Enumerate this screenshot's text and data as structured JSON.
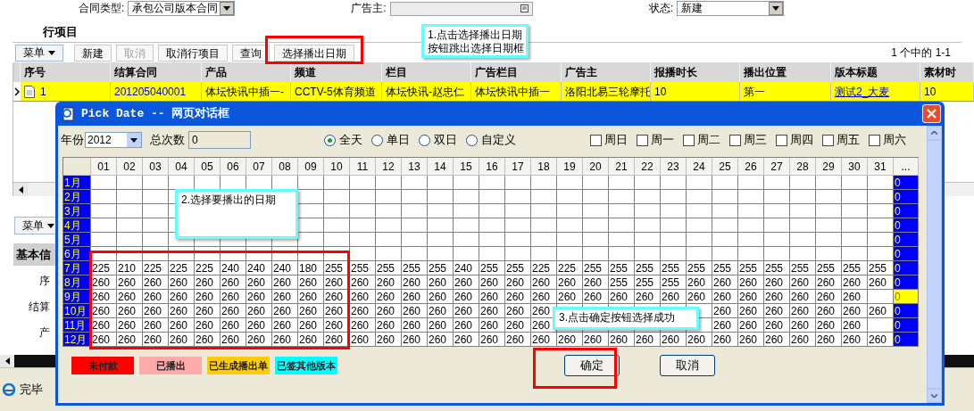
{
  "form": [
    {
      "label": "合同类型:",
      "value": "承包公司版本合同",
      "kind": "select"
    },
    {
      "label": "广告主:",
      "kind": "lookup"
    },
    {
      "label": "状态:",
      "value": "新建",
      "kind": "select"
    }
  ],
  "section_title": "行项目",
  "toolbar": [
    {
      "label": "菜单",
      "kind": "menu",
      "disabled": false
    },
    {
      "label": "新建",
      "kind": "button",
      "disabled": false
    },
    {
      "label": "取消",
      "kind": "button",
      "disabled": true
    },
    {
      "label": "取消行项目",
      "kind": "button",
      "disabled": false
    },
    {
      "label": "查询",
      "kind": "button",
      "disabled": false
    },
    {
      "label": "选择播出日期",
      "kind": "button",
      "disabled": false
    }
  ],
  "pager": "1 个中的 1-1",
  "table": {
    "columns": [
      "序号",
      "结算合同",
      "产品",
      "频道",
      "栏目",
      "广告栏目",
      "广告主",
      "报播时长",
      "播出位置",
      "版本标题",
      "素材时"
    ],
    "rows": [
      {
        "selected": true,
        "cells": [
          {
            "text": "1",
            "kind": "text"
          },
          {
            "text": "201205040001",
            "kind": "link"
          },
          {
            "text": "体坛快讯中插一-",
            "kind": "text"
          },
          {
            "text": "CCTV-5体育频道",
            "kind": "text"
          },
          {
            "text": "体坛快讯-赵忠仁",
            "kind": "text"
          },
          {
            "text": "体坛快讯中插一",
            "kind": "text"
          },
          {
            "text": "洛阳北易三轮摩托",
            "kind": "text"
          },
          {
            "text": "10",
            "kind": "text"
          },
          {
            "text": "第一",
            "kind": "text"
          },
          {
            "text": "测试2_大麦",
            "kind": "underline"
          },
          {
            "text": "10",
            "kind": "text"
          }
        ]
      }
    ]
  },
  "lower": {
    "menu": "菜单",
    "section": "基本信",
    "fields": [
      "序",
      "结算",
      "产"
    ]
  },
  "status_bar": {
    "text": "完毕"
  },
  "dialog": {
    "title": "Pick Date -- 网页对话框",
    "year": {
      "label": "年份",
      "value": "2012"
    },
    "total": {
      "label": "总次数",
      "value": "0"
    },
    "day_modes": [
      {
        "label": "全天",
        "selected": true
      },
      {
        "label": "单日",
        "selected": false
      },
      {
        "label": "双日",
        "selected": false
      },
      {
        "label": "自定义",
        "selected": false
      }
    ],
    "weekdays": [
      {
        "label": "周日",
        "checked": false
      },
      {
        "label": "周一",
        "checked": false
      },
      {
        "label": "周二",
        "checked": false
      },
      {
        "label": "周三",
        "checked": false
      },
      {
        "label": "周四",
        "checked": false
      },
      {
        "label": "周五",
        "checked": false
      },
      {
        "label": "周六",
        "checked": false
      }
    ],
    "grid": {
      "columns": [
        "01",
        "02",
        "03",
        "04",
        "05",
        "06",
        "07",
        "08",
        "09",
        "10",
        "11",
        "12",
        "13",
        "14",
        "15",
        "16",
        "17",
        "18",
        "19",
        "20",
        "21",
        "22",
        "23",
        "24",
        "25",
        "26",
        "27",
        "28",
        "29",
        "30",
        "31",
        "..."
      ],
      "rows": [
        {
          "label": "1月",
          "total": "0",
          "highlighted": false
        },
        {
          "label": "2月",
          "total": "0",
          "highlighted": false
        },
        {
          "label": "3月",
          "total": "0",
          "highlighted": false
        },
        {
          "label": "4月",
          "total": "0",
          "highlighted": false
        },
        {
          "label": "5月",
          "total": "0",
          "highlighted": false
        },
        {
          "label": "6月",
          "total": "0",
          "highlighted": false
        },
        {
          "label": "7月",
          "total": "0",
          "highlighted": false,
          "cells": [
            "225",
            "210",
            "225",
            "225",
            "225",
            "240",
            "240",
            "240",
            "180",
            "255",
            "255",
            "255",
            "255",
            "255",
            "240",
            "255",
            "255",
            "225",
            "225",
            "255",
            "255",
            "255",
            "255",
            "255",
            "255",
            "255",
            "255",
            "255",
            "255",
            "255",
            "255"
          ]
        },
        {
          "label": "8月",
          "total": "0",
          "highlighted": false,
          "cells": [
            "260",
            "260",
            "260",
            "260",
            "260",
            "260",
            "260",
            "260",
            "260",
            "260",
            "260",
            "260",
            "260",
            "260",
            "260",
            "260",
            "260",
            "260",
            "260",
            "260",
            "255",
            "255",
            "255",
            "260",
            "260",
            "260",
            "260",
            "260",
            "260",
            "260",
            "260"
          ]
        },
        {
          "label": "9月",
          "total": "0",
          "highlighted": true,
          "cells": [
            "260",
            "260",
            "260",
            "260",
            "260",
            "260",
            "260",
            "260",
            "260",
            "260",
            "260",
            "260",
            "260",
            "260",
            "260",
            "260",
            "260",
            "260",
            "260",
            "260",
            "260",
            "260",
            "260",
            "260",
            "260",
            "260",
            "260",
            "260",
            "260",
            "260",
            null
          ]
        },
        {
          "label": "10月",
          "total": "0",
          "highlighted": false,
          "cells": [
            "260",
            "260",
            "260",
            "260",
            "260",
            "260",
            "260",
            "260",
            "260",
            "260",
            "260",
            "260",
            "260",
            "260",
            "260",
            "260",
            "260",
            "260",
            null,
            null,
            null,
            null,
            null,
            null,
            "260",
            "260",
            "260",
            "260",
            "260",
            "260",
            "260"
          ]
        },
        {
          "label": "11月",
          "total": "0",
          "highlighted": false,
          "cells": [
            "260",
            "260",
            "260",
            "260",
            "260",
            "260",
            "260",
            "260",
            "260",
            "260",
            "260",
            "260",
            "260",
            "260",
            "260",
            "260",
            "260",
            "260",
            null,
            null,
            null,
            null,
            null,
            null,
            "260",
            "260",
            "260",
            "260",
            "260",
            "260",
            null
          ]
        },
        {
          "label": "12月",
          "total": "0",
          "highlighted": false,
          "cells": [
            "260",
            "260",
            "260",
            "260",
            "260",
            "260",
            "260",
            "260",
            "260",
            "260",
            "260",
            "260",
            "260",
            "260",
            "260",
            "260",
            "260",
            "260",
            "260",
            "260",
            "260",
            "260",
            "260",
            "260",
            "260",
            "260",
            "260",
            "260",
            "260",
            "260",
            "260"
          ]
        }
      ]
    },
    "legend": [
      {
        "label": "未付款",
        "color": "#ff0000"
      },
      {
        "label": "已播出",
        "color": "#ffaaaa"
      },
      {
        "label": "已生成播出单",
        "color": "#ffcc00"
      },
      {
        "label": "已签其他版本",
        "color": "#00ffff"
      }
    ],
    "buttons": [
      "确定",
      "取消"
    ]
  },
  "callouts": [
    {
      "lines": [
        "1.点击选择播出日期",
        "按钮跳出选择日期框"
      ]
    },
    {
      "lines": [
        "2.选择要播出的日期"
      ]
    },
    {
      "lines": [
        "3.点击确定按钮选择成功"
      ]
    }
  ]
}
